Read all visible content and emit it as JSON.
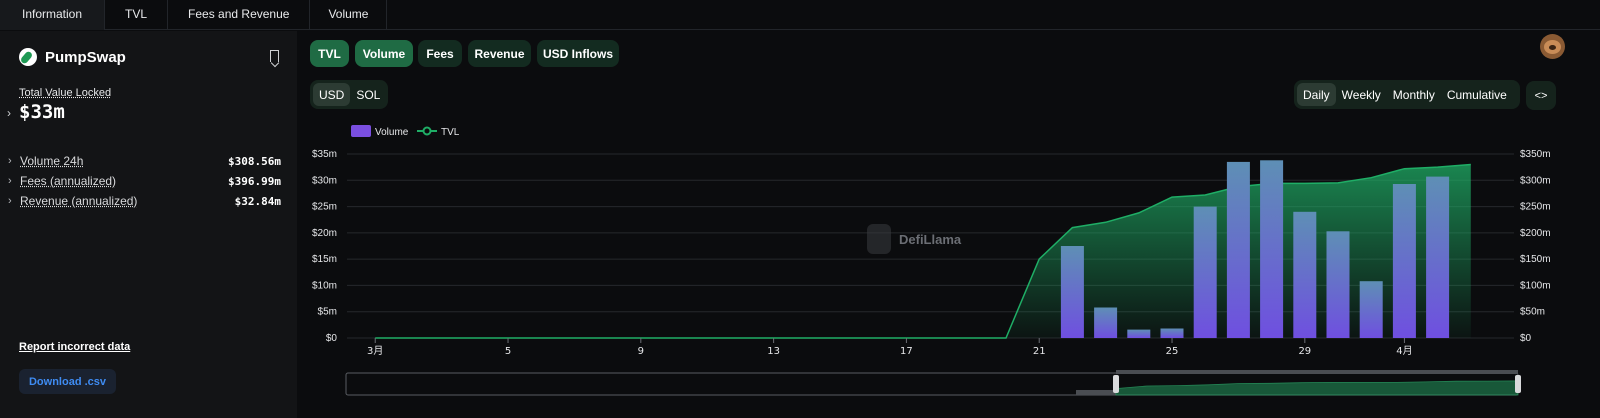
{
  "tabs": [
    "Information",
    "TVL",
    "Fees and Revenue",
    "Volume"
  ],
  "protocol": {
    "name": "PumpSwap",
    "tvl_label": "Total Value Locked",
    "tvl_value": "$33m"
  },
  "metrics": [
    {
      "label": "Volume 24h",
      "value": "$308.56m"
    },
    {
      "label": "Fees (annualized)",
      "value": "$396.99m"
    },
    {
      "label": "Revenue (annualized)",
      "value": "$32.84m"
    }
  ],
  "links": {
    "report": "Report incorrect data",
    "download": "Download .csv"
  },
  "metric_toggles": [
    {
      "label": "TVL",
      "active": true
    },
    {
      "label": "Volume",
      "active": true
    },
    {
      "label": "Fees",
      "active": false
    },
    {
      "label": "Revenue",
      "active": false
    },
    {
      "label": "USD Inflows",
      "active": false
    }
  ],
  "denomination": {
    "options": [
      "USD",
      "SOL"
    ],
    "selected": "USD"
  },
  "grouping": {
    "options": [
      "Daily",
      "Weekly",
      "Monthly",
      "Cumulative"
    ],
    "selected": "Daily"
  },
  "embed_label": "<>",
  "watermark": "DefiLlama",
  "colors": {
    "volume": "#7a4fe0",
    "tvl": "#1fae66",
    "accent": "#1f6b44"
  },
  "chart_data": {
    "type": "bar",
    "x": [
      "3月",
      "5",
      "9",
      "13",
      "17",
      "21",
      "25",
      "29",
      "4月"
    ],
    "legend": [
      "Volume",
      "TVL"
    ],
    "left_axis_ticks": [
      "$0",
      "$5m",
      "$10m",
      "$15m",
      "$20m",
      "$25m",
      "$30m",
      "$35m"
    ],
    "right_axis_ticks": [
      "$0",
      "$50m",
      "$100m",
      "$150m",
      "$200m",
      "$250m",
      "$300m",
      "$350m"
    ],
    "left_ylim": [
      0,
      35
    ],
    "right_ylim": [
      0,
      350
    ],
    "grid": true,
    "legend_position": "top-left",
    "volume_m": [
      {
        "day": 22,
        "v": 17.5
      },
      {
        "day": 23,
        "v": 5.8
      },
      {
        "day": 24,
        "v": 1.6
      },
      {
        "day": 25,
        "v": 1.8
      },
      {
        "day": 26,
        "v": 25.0
      },
      {
        "day": 27,
        "v": 33.5
      },
      {
        "day": 28,
        "v": 33.8
      },
      {
        "day": 29,
        "v": 24.0
      },
      {
        "day": 30,
        "v": 20.3
      },
      {
        "day": 31,
        "v": 10.8
      },
      {
        "day": 32,
        "v": 29.3
      },
      {
        "day": 33,
        "v": 30.7
      }
    ],
    "tvl_m": [
      {
        "day": 1,
        "v": 0
      },
      {
        "day": 20,
        "v": 0
      },
      {
        "day": 21,
        "v": 150
      },
      {
        "day": 22,
        "v": 210
      },
      {
        "day": 23,
        "v": 220
      },
      {
        "day": 24,
        "v": 238
      },
      {
        "day": 25,
        "v": 268
      },
      {
        "day": 26,
        "v": 272
      },
      {
        "day": 27,
        "v": 288
      },
      {
        "day": 28,
        "v": 294
      },
      {
        "day": 29,
        "v": 294
      },
      {
        "day": 30,
        "v": 295
      },
      {
        "day": 31,
        "v": 305
      },
      {
        "day": 32,
        "v": 322
      },
      {
        "day": 33,
        "v": 325
      },
      {
        "day": 34,
        "v": 330
      }
    ]
  }
}
